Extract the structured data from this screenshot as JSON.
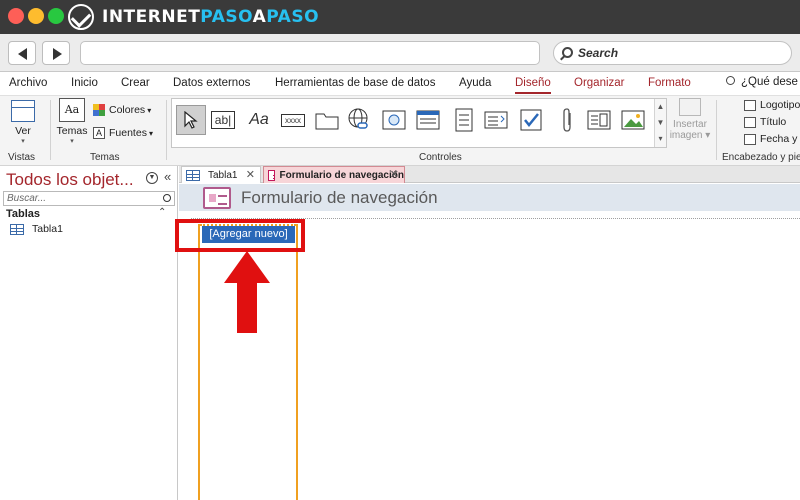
{
  "browser": {
    "brand_part1": "INTERNET",
    "brand_part2": "PASO",
    "brand_part3": "A",
    "brand_part4": "PASO",
    "search_placeholder": "Search"
  },
  "menu": {
    "items": [
      "Archivo",
      "Inicio",
      "Crear",
      "Datos externos",
      "Herramientas de base de datos",
      "Ayuda"
    ],
    "active": "Diseño",
    "context_items": [
      "Organizar",
      "Formato"
    ],
    "tell_me": "¿Qué dese"
  },
  "ribbon": {
    "vistas": {
      "button_label": "Ver",
      "group_label": "Vistas"
    },
    "temas": {
      "button_label": "Temas",
      "colores_label": "Colores",
      "fuentes_label": "Fuentes",
      "group_label": "Temas"
    },
    "controles": {
      "group_label": "Controles",
      "textbox_glyph": "ab|",
      "label_glyph": "Aa",
      "button_glyph": "xxxx"
    },
    "insertar_imagen": {
      "line1": "Insertar",
      "line2": "imagen"
    },
    "encabezado": {
      "logotipo": "Logotipo",
      "titulo": "Título",
      "fecha_hora": "Fecha y h",
      "group_label": "Encabezado y pie"
    }
  },
  "nav_pane": {
    "title": "Todos los objet...",
    "search_placeholder": "Buscar...",
    "category": "Tablas",
    "items": [
      {
        "label": "Tabla1"
      }
    ]
  },
  "tabs": [
    {
      "label": "Tabla1"
    },
    {
      "label": "Formulario de navegación"
    }
  ],
  "form": {
    "title": "Formulario de navegación",
    "add_new_label": "[Agregar nuevo]"
  },
  "colors": {
    "accent": "#a4262c",
    "highlight_red": "#e01010",
    "nav_orange": "#f0a020",
    "button_blue": "#2a68b8"
  }
}
